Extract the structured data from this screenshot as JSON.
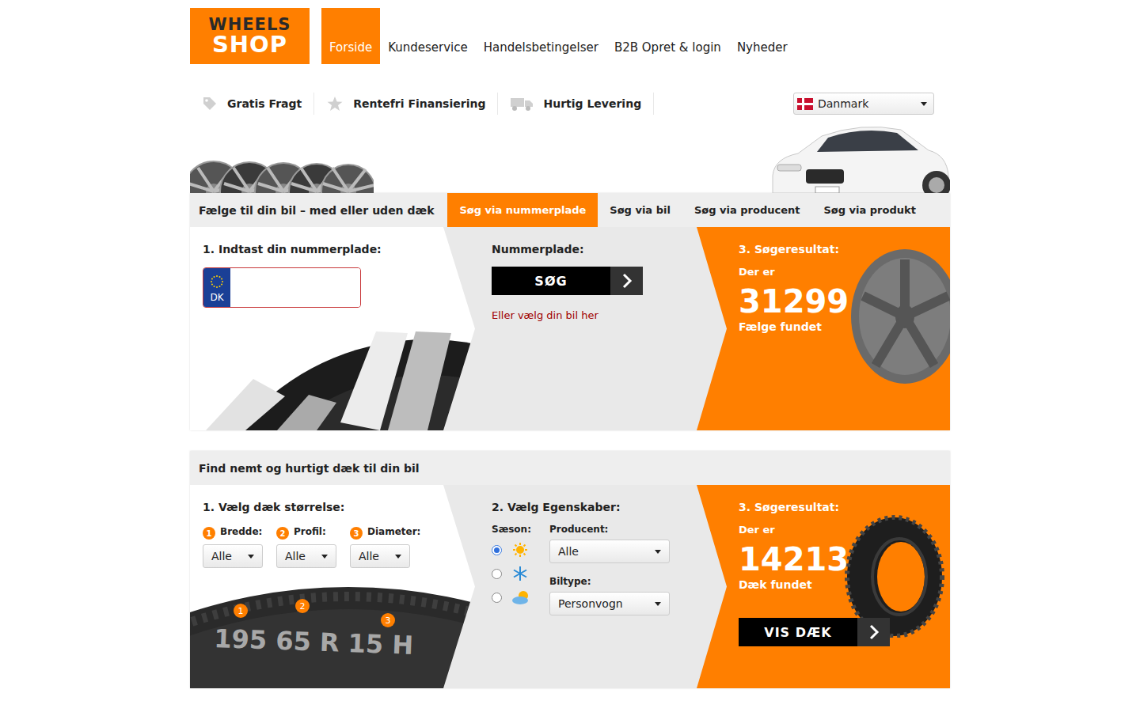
{
  "logo": {
    "line1": "WHEELS",
    "line2": "SHOP"
  },
  "nav": [
    {
      "label": "Forside",
      "selected": true
    },
    {
      "label": "Kundeservice",
      "selected": false
    },
    {
      "label": "Handelsbetingelser",
      "selected": false
    },
    {
      "label": "B2B Opret & login",
      "selected": false
    },
    {
      "label": "Nyheder",
      "selected": false
    }
  ],
  "features": [
    {
      "label": "Gratis Fragt",
      "kind": "tag"
    },
    {
      "label": "Rentefri Finansiering",
      "kind": "star"
    },
    {
      "label": "Hurtig Levering",
      "kind": "truck"
    }
  ],
  "country": {
    "label": "Danmark"
  },
  "rims": {
    "heading": "Fælge til din bil – med eller uden dæk",
    "tabs": [
      {
        "label": "Søg via nummerplade",
        "selected": true
      },
      {
        "label": "Søg via bil",
        "selected": false
      },
      {
        "label": "Søg via producent",
        "selected": false
      },
      {
        "label": "Søg via produkt",
        "selected": false
      }
    ],
    "step1": {
      "title": "1. Indtast din nummerplade:",
      "plate_badge": "DK"
    },
    "step2": {
      "title": "Nummerplade:",
      "button": "SØG",
      "link": "Eller vælg din bil her"
    },
    "result": {
      "title": "3. Søgeresultat:",
      "prefix": "Der er",
      "count": "31299",
      "suffix": "Fælge fundet"
    }
  },
  "tires": {
    "heading": "Find nemt og hurtigt dæk til din bil",
    "step1": {
      "title": "1. Vælg dæk størrelse:",
      "fields": [
        {
          "number": "1",
          "label": "Bredde:",
          "value": "Alle"
        },
        {
          "number": "2",
          "label": "Profil:",
          "value": "Alle"
        },
        {
          "number": "3",
          "label": "Diameter:",
          "value": "Alle"
        }
      ],
      "marking": "195 65 R 15 H",
      "marker_numbers": [
        "1",
        "2",
        "3"
      ]
    },
    "step2": {
      "title": "2. Vælg Egenskaber:",
      "season_label": "Sæson:",
      "seasons": [
        {
          "kind": "summer",
          "selected": true
        },
        {
          "kind": "winter",
          "selected": false
        },
        {
          "kind": "allseason",
          "selected": false
        }
      ],
      "producer": {
        "label": "Producent:",
        "value": "Alle"
      },
      "cartype": {
        "label": "Biltype:",
        "value": "Personvogn"
      }
    },
    "result": {
      "title": "3. Søgeresultat:",
      "prefix": "Der er",
      "count": "14213",
      "suffix": "Dæk fundet",
      "button": "VIS DÆK"
    }
  }
}
